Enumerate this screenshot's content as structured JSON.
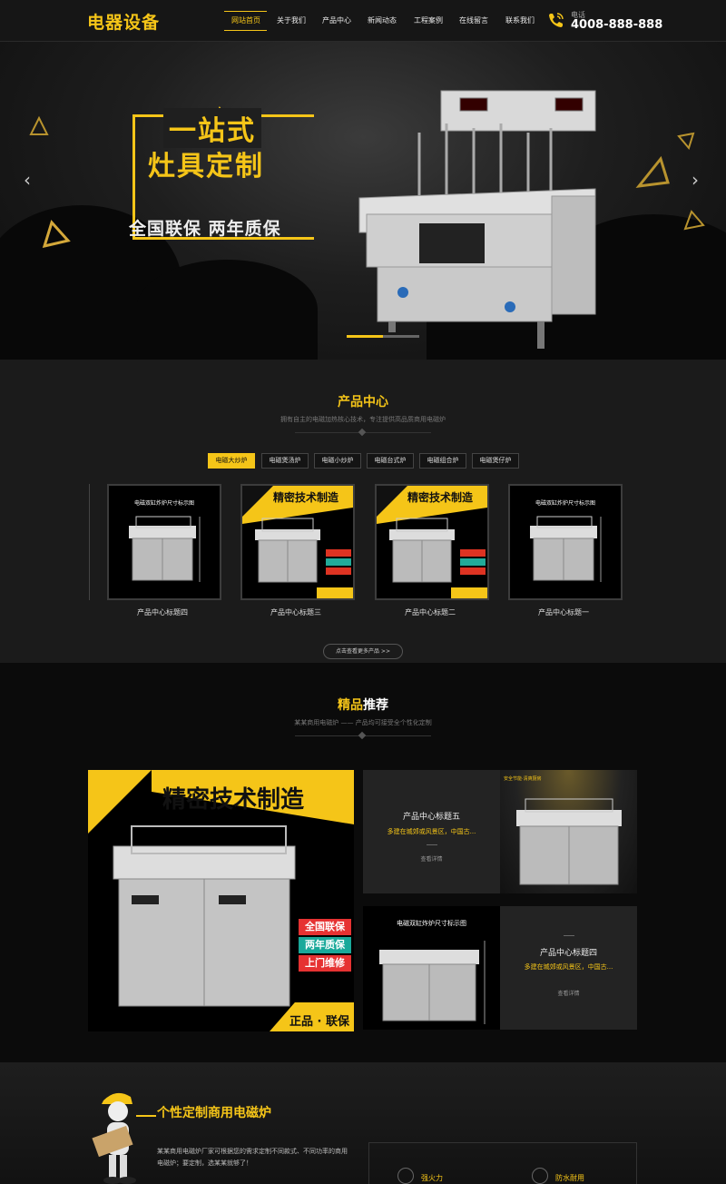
{
  "header": {
    "logo": "电器设备",
    "nav": [
      "网站首页",
      "关于我们",
      "产品中心",
      "新闻动态",
      "工程案例",
      "在线留言",
      "联系我们"
    ],
    "phone_label": "电话",
    "phone_number": "4008-888-888"
  },
  "banner": {
    "title_line1": "一站式",
    "title_line2": "灶具定制",
    "subtitle": "全国联保  两年质保"
  },
  "products": {
    "title": "产品中心",
    "subtitle": "拥有自主的电磁加热核心技术，专注提供高品质商用电磁炉",
    "tabs": [
      "电磁大炒炉",
      "电磁煲汤炉",
      "电磁小炒炉",
      "电磁台式炉",
      "电磁组合炉",
      "电磁煲仔炉"
    ],
    "items": [
      {
        "label": "产品中心标题四",
        "badge": "电磁双缸炸炉尺寸标示图"
      },
      {
        "label": "产品中心标题三",
        "badge": "精密技术制造"
      },
      {
        "label": "产品中心标题二",
        "badge": "精密技术制造"
      },
      {
        "label": "产品中心标题一",
        "badge": "电磁双缸炸炉尺寸标示图"
      }
    ],
    "more_button": "点击查看更多产品 >>"
  },
  "recommend": {
    "title_prefix": "精品",
    "title_suffix": "推荐",
    "subtitle": "某某商用电磁炉 —— 产品均可接受全个性化定制",
    "big_banner_text": "精密技术制造",
    "big_badges": [
      "全国联保",
      "两年质保",
      "上门维修"
    ],
    "big_footer": "正品 · 联保",
    "card_top": {
      "title": "产品中心标题五",
      "desc": "多建在城郊或风景区，中国古...",
      "link": "查看详情"
    },
    "card_bottom": {
      "title": "产品中心标题四",
      "desc": "多建在城郊或风景区，中国古...",
      "link": "查看详情"
    },
    "image_top_caption": "安全节能·清爽厨房",
    "image_bottom_caption": "电磁双缸炸炉尺寸标示图"
  },
  "custom": {
    "title": "个性定制商用电磁炉",
    "description": "某某商用电磁炉厂家可根据您的需求定制不同款式、不同功率的商用电磁炉；要定制，选某某就够了！",
    "features": [
      "强火力",
      "防水耐用"
    ]
  },
  "colors": {
    "accent": "#f5c518",
    "background": "#121212"
  }
}
